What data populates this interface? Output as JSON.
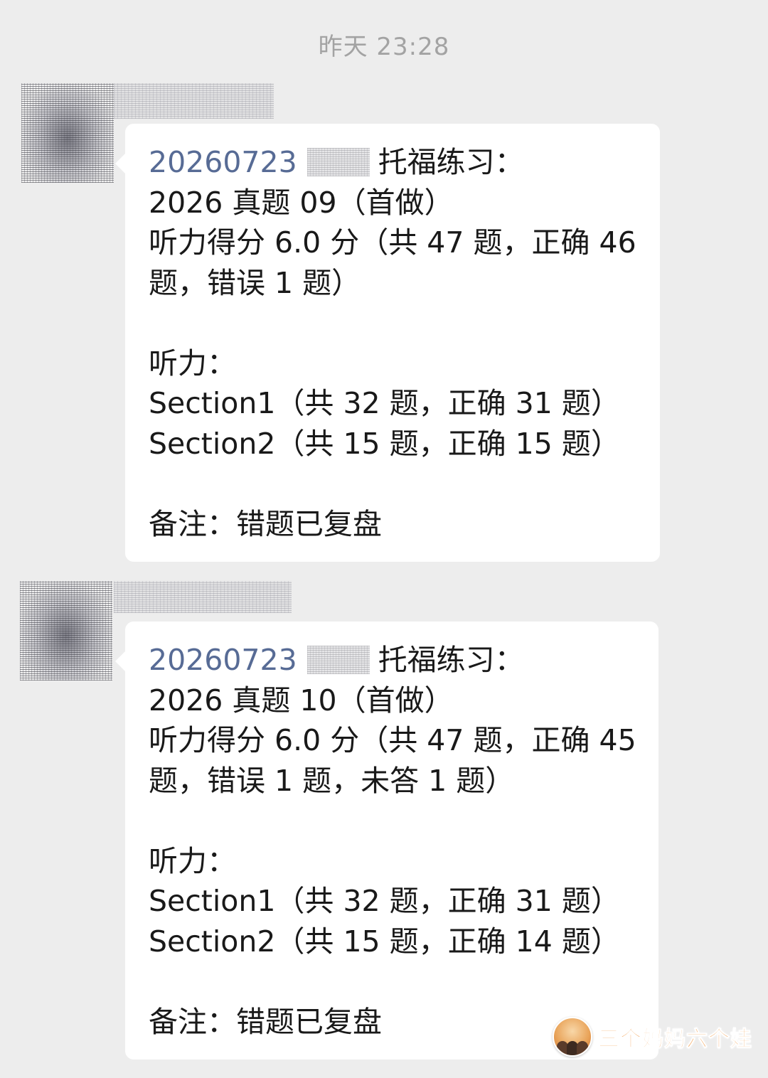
{
  "chat": {
    "timestamp": "昨天 23:28"
  },
  "messages": [
    {
      "date": "20260723",
      "title_suffix": "托福练习：",
      "lines": [
        "2026 真题 09（首做）",
        "听力得分 6.0 分（共 47 题，正确 46",
        "题，错误 1 题）",
        "",
        "听力：",
        "Section1（共 32 题，正确 31 题）",
        "Section2（共 15 题，正确 15 题）",
        "",
        "备注：错题已复盘"
      ]
    },
    {
      "date": "20260723",
      "title_suffix": "托福练习：",
      "lines": [
        "2026 真题 10（首做）",
        "听力得分 6.0 分（共 47 题，正确 45",
        "题，错误 1 题，未答 1 题）",
        "",
        "听力：",
        "Section1（共 32 题，正确 31 题）",
        "Section2（共 15 题，正确 14 题）",
        "",
        "备注：错题已复盘"
      ]
    }
  ],
  "watermark": {
    "text": "三个妈妈六个娃",
    "logo_icon": "three-moms-logo-icon"
  },
  "colors": {
    "background": "#ededed",
    "bubble": "#ffffff",
    "link": "#576b95",
    "timestamp": "#a3a3a3",
    "watermark_text": "#f08c2d"
  }
}
